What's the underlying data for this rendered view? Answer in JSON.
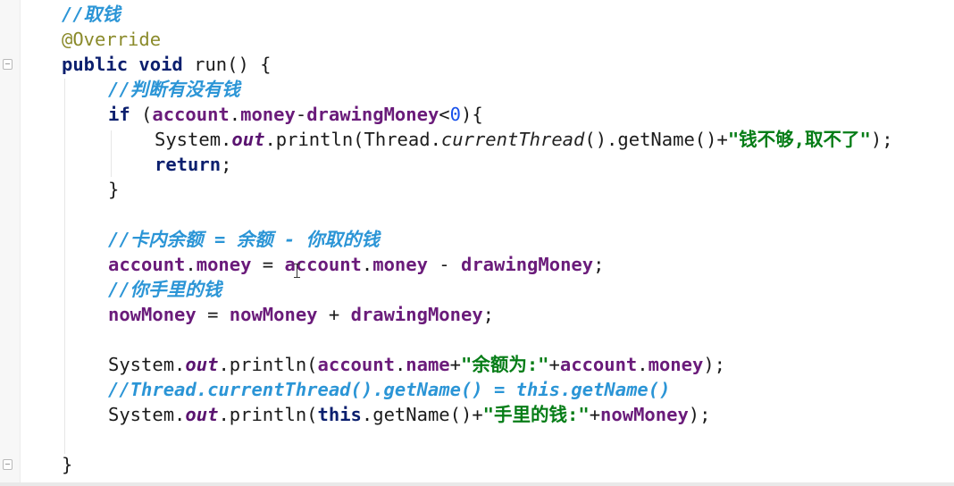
{
  "editor": {
    "lines": {
      "comment_withdraw": "//取钱",
      "annotation": "@Override",
      "kw_public": "public",
      "kw_void": "void",
      "method_run": " run() {",
      "comment_check": "//判断有没有钱",
      "kw_if": "if",
      "if_open": " (",
      "account1": "account",
      "dot1": ".",
      "money1": "money",
      "minus1": "-",
      "drawing1": "drawingMoney",
      "lt": "<",
      "zero": "0",
      "if_close": "){",
      "sys1": "System.",
      "out1": "out",
      "println1": ".println(Thread.",
      "currentThread": "currentThread",
      "getname1": "().getName()+",
      "str_not_enough": "\"钱不够,取不了\"",
      "close1": ");",
      "kw_return": "return",
      "semi": ";",
      "brace_close_inner": "}",
      "comment_balance": "//卡内余额 = 余额 - 你取的钱",
      "account2": "account",
      "dot2": ".",
      "money2": "money",
      "eq2": " = ",
      "account3": "account",
      "dot3": ".",
      "money3": "money",
      "minus3": " - ",
      "drawing3": "drawingMoney",
      "semi3": ";",
      "comment_hand": "//你手里的钱",
      "now1": "nowMoney",
      "eq4": " = ",
      "now2": "nowMoney",
      "plus4": " + ",
      "drawing4": "drawingMoney",
      "semi4": ";",
      "sys5": "System.",
      "out5": "out",
      "println5": ".println(",
      "account5": "account",
      "dot5": ".",
      "name5": "name",
      "plus5": "+",
      "str_balance": "\"余额为:\"",
      "plus5b": "+",
      "account5b": "account",
      "dot5b": ".",
      "money5b": "money",
      "close5": ");",
      "comment_thread": "//Thread.currentThread().getName() = this.getName()",
      "sys6": "System.",
      "out6": "out",
      "println6": ".println(",
      "kw_this": "this",
      "getname6": ".getName()+",
      "str_hand": "\"手里的钱:\"",
      "plus6": "+",
      "now6": "nowMoney",
      "close6": ");",
      "brace_close_outer": "}"
    }
  },
  "colors": {
    "keyword": "#0b1f6e",
    "field": "#6a1b7a",
    "string": "#067d17",
    "comment": "#2b95d6",
    "annotation": "#8a8a2a"
  }
}
